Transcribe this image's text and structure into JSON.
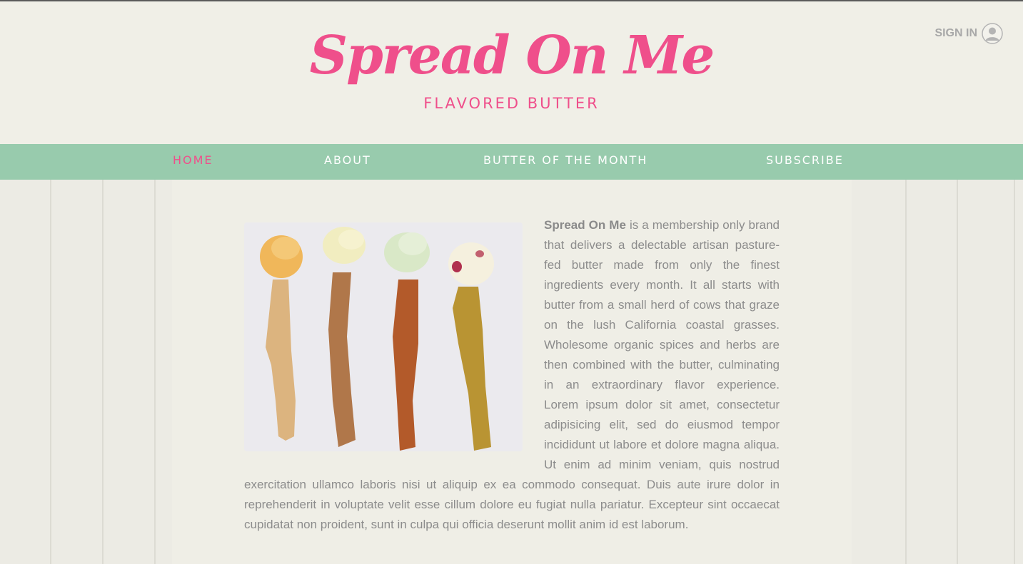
{
  "header": {
    "title": "Spread On Me",
    "subtitle": "FLAVORED BUTTER",
    "sign_in_label": "SIGN IN"
  },
  "nav": {
    "items": [
      {
        "label": "HOME",
        "active": true
      },
      {
        "label": "ABOUT",
        "active": false
      },
      {
        "label": "BUTTER OF THE MONTH",
        "active": false
      },
      {
        "label": "SUBSCRIBE",
        "active": false
      }
    ]
  },
  "main": {
    "intro_bold": "Spread On Me",
    "intro_text": " is a membership only brand that delivers a delectable artisan pasture-fed butter made from only the finest ingredients every month. It all starts with butter from a small herd of cows that graze on the lush California coastal grasses. Wholesome organic spices and herbs are then combined with the butter, culminating in an extraordinary flavor experience. Lorem ipsum dolor sit amet, consectetur adipisicing elit, sed do eiusmod tempor incididunt ut labore et dolore magna aliqua. Ut enim ad minim veniam, quis nostrud exercitation ullamco laboris nisi ut aliquip ex ea commodo consequat. Duis aute irure dolor in reprehenderit in voluptate velit esse cillum dolore eu fugiat nulla pariatur. Excepteur sint occaecat cupidatat non proident, sunt in culpa qui officia deserunt mollit anim id est laborum."
  },
  "colors": {
    "brand_pink": "#ef4f8b",
    "nav_green": "#98cbad",
    "background": "#efeee6",
    "body_text": "#8c8c8c"
  },
  "icons": {
    "sign_in": "user-circle-icon"
  }
}
